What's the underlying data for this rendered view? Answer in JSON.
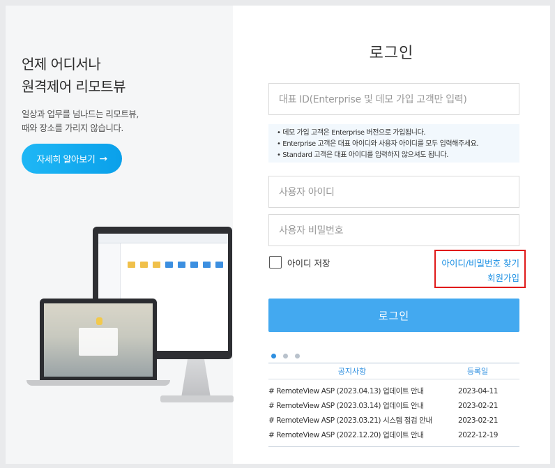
{
  "promo": {
    "headline_line1": "언제 어디서나",
    "headline_line2": "원격제어 리모트뷰",
    "sub_line1": "일상과 업무를 넘나드는 리모트뷰,",
    "sub_line2": "때와 장소를 가리지 않습니다.",
    "learn_more_label": "자세히 알아보기",
    "learn_more_icon": "arrow-right-icon"
  },
  "login": {
    "title": "로그인",
    "rep_id_placeholder": "대표 ID(Enterprise 및 데모 가입 고객만 입력)",
    "notice_lines": [
      "• 데모 가입 고객은 Enterprise 버전으로 가입됩니다.",
      "• Enterprise 고객은 대표 아이디와 사용자 아이디를 모두 입력해주세요.",
      "• Standard 고객은 대표 아이디를 입력하지 않으셔도 됩니다."
    ],
    "user_id_placeholder": "사용자 아이디",
    "password_placeholder": "사용자 비밀번호",
    "remember_label": "아이디 저장",
    "find_label": "아이디/비밀번호 찾기",
    "join_label": "회원가입",
    "submit_label": "로그인"
  },
  "notices": {
    "header_title": "공지사항",
    "header_date": "등록일",
    "rows": [
      {
        "title": "# RemoteView ASP (2023.04.13) 업데이트 안내",
        "date": "2023-04-11"
      },
      {
        "title": "# RemoteView ASP (2023.03.14) 업데이트 안내",
        "date": "2023-02-21"
      },
      {
        "title": "# RemoteView ASP (2023.03.21) 시스템 점검 안내",
        "date": "2023-02-21"
      },
      {
        "title": "# RemoteView ASP (2022.12.20) 업데이트 안내",
        "date": "2022-12-19"
      }
    ]
  },
  "colors": {
    "accent": "#43a9f0",
    "link": "#1a8fe3",
    "highlight_border": "#e01a1a"
  }
}
